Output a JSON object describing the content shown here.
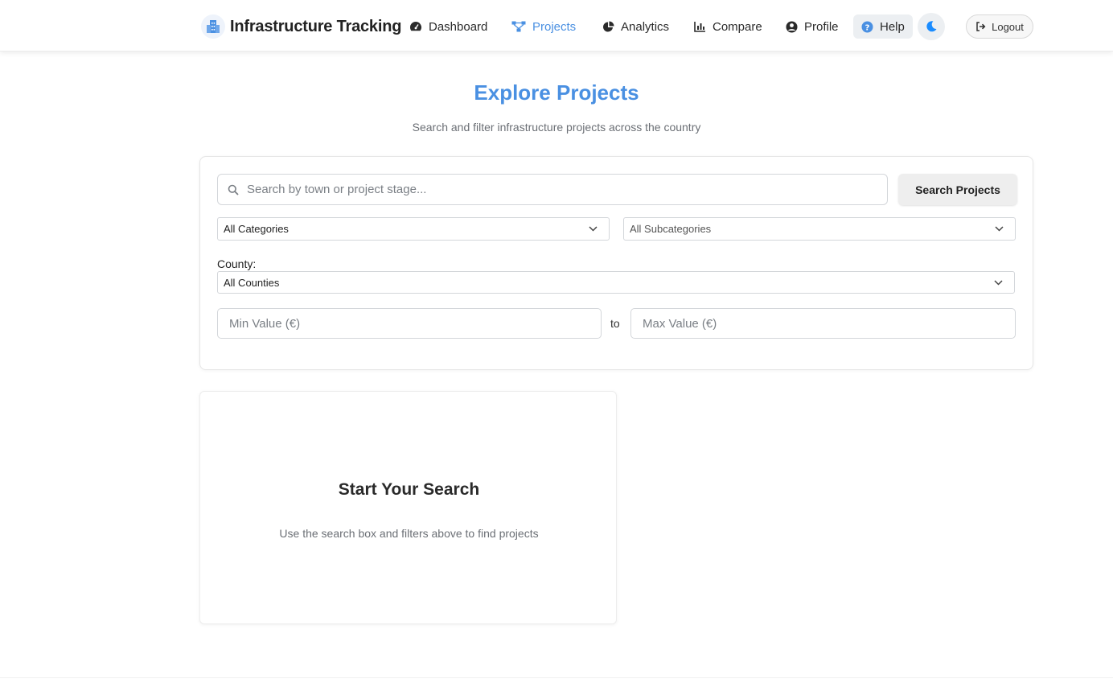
{
  "app": {
    "title": "Infrastructure Tracking",
    "icon": "building-icon"
  },
  "nav": {
    "items": [
      {
        "label": "Dashboard",
        "icon": "gauge-icon",
        "active": false
      },
      {
        "label": "Projects",
        "icon": "sitemap-icon",
        "active": true
      },
      {
        "label": "Analytics",
        "icon": "pie-chart-icon",
        "active": false
      },
      {
        "label": "Compare",
        "icon": "bar-chart-icon",
        "active": false
      },
      {
        "label": "Profile",
        "icon": "user-circle-icon",
        "active": false
      },
      {
        "label": "Help",
        "icon": "question-circle-icon",
        "active": false
      }
    ],
    "theme_toggle_icon": "moon-icon",
    "logout_label": "Logout",
    "logout_icon": "sign-out-icon"
  },
  "header": {
    "title": "Explore Projects",
    "subtitle": "Search and filter infrastructure projects across the country"
  },
  "filters": {
    "search_placeholder": "Search by town or project stage...",
    "search_button": "Search Projects",
    "category_value": "All Categories",
    "subcategory_value": "All Subcategories",
    "county_label": "County:",
    "county_value": "All Counties",
    "min_placeholder": "Min Value (€)",
    "to_label": "to",
    "max_placeholder": "Max Value (€)"
  },
  "empty_state": {
    "title": "Start Your Search",
    "text": "Use the search box and filters above to find projects"
  },
  "colors": {
    "accent": "#4a90e2",
    "text": "#222222",
    "muted": "#6b6f75",
    "moon": "#1a8cff"
  }
}
